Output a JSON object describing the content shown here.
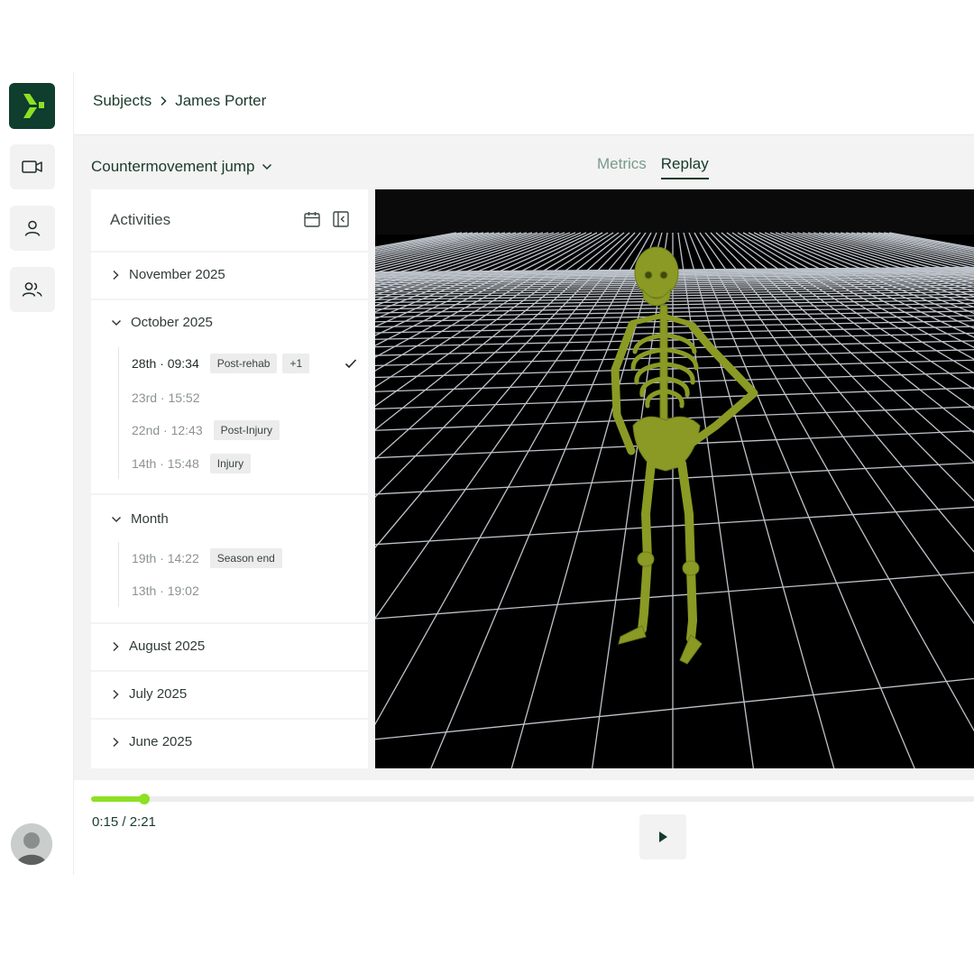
{
  "app": {
    "logo_icon": "logo-mark-icon",
    "brand_color": "#0f3d2e",
    "accent_color": "#8ee024"
  },
  "rail": {
    "items": [
      {
        "icon": "video-camera-icon"
      },
      {
        "icon": "user-icon"
      },
      {
        "icon": "users-icon"
      }
    ],
    "avatar_icon": "user-avatar"
  },
  "breadcrumb": {
    "root": "Subjects",
    "current": "James Porter"
  },
  "toolbar": {
    "test_selector": "Countermovement jump",
    "tabs": [
      {
        "label": "Metrics",
        "active": false
      },
      {
        "label": "Replay",
        "active": true
      }
    ]
  },
  "activities": {
    "title": "Activities",
    "groups": [
      {
        "label": "November 2025",
        "expanded": false,
        "items": []
      },
      {
        "label": "October 2025",
        "expanded": true,
        "items": [
          {
            "date": "28th · 09:34",
            "tag": "Post-rehab",
            "extra_tag": "+1",
            "selected": true
          },
          {
            "date": "23rd · 15:52",
            "tag": "",
            "selected": false
          },
          {
            "date": "22nd · 12:43",
            "tag": "Post-Injury",
            "selected": false
          },
          {
            "date": "14th · 15:48",
            "tag": "Injury",
            "selected": false
          }
        ]
      },
      {
        "label": "Month",
        "expanded": true,
        "items": [
          {
            "date": "19th · 14:22",
            "tag": "Season end",
            "selected": false
          },
          {
            "date": "13th · 19:02",
            "tag": "",
            "selected": false
          }
        ]
      },
      {
        "label": "August 2025",
        "expanded": false,
        "items": []
      },
      {
        "label": "July 2025",
        "expanded": false,
        "items": []
      },
      {
        "label": "June 2025",
        "expanded": false,
        "items": []
      }
    ]
  },
  "player": {
    "time": "0:15 / 2:21",
    "progress": 0.06
  }
}
